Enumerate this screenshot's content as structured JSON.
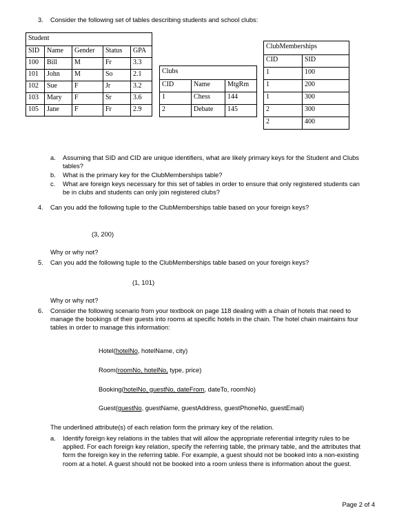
{
  "questions": {
    "q3": {
      "marker": "3.",
      "text": "Consider the following set of tables describing students and school clubs:"
    },
    "q3_subitems": [
      {
        "marker": "a.",
        "text": "Assuming that SID and CID are unique identifiers, what are likely primary keys for the Student and Clubs tables?"
      },
      {
        "marker": "b.",
        "text": "What is the primary key for the ClubMemberships table?"
      },
      {
        "marker": "c.",
        "text": "What are foreign keys necessary for this set of tables in order to ensure that only registered students can be in clubs and students can only join registered clubs?"
      }
    ],
    "q4": {
      "marker": "4.",
      "text": "Can you add the following tuple to the ClubMemberships table based on your foreign keys?",
      "tuple": "(3, 200)",
      "followup": "Why or why not?"
    },
    "q5": {
      "marker": "5.",
      "text": "Can you add the following tuple to the ClubMemberships table based on your foreign keys?",
      "tuple": "(1, 101)",
      "followup": "Why or why not?"
    },
    "q6": {
      "marker": "6.",
      "text": "Consider the following scenario from your textbook on page 118 dealing with a chain of hotels that need to manage the bookings of their guests into rooms at specific hotels in the chain. The hotel chain maintains four tables in order to manage this information:",
      "note": "The underlined attribute(s) of each relation form the primary key of the relation.",
      "subitems": [
        {
          "marker": "a.",
          "text": "Identify foreign key relations in the tables that will allow the appropriate referential integrity rules to be applied. For each foreign key relation, specify the referring table, the primary table, and the attributes that form the foreign key in the referring table. For example, a guest should not be booked into a non-existing room at a hotel. A guest should not be booked into a room unless there is information about the guest."
        }
      ]
    }
  },
  "schemas": [
    {
      "name": "Hotel",
      "open": "(",
      "key": "hotelNo",
      "rest": ", hotelName, city)"
    },
    {
      "name": "Room",
      "open": "(",
      "key": "roomNo, hotelNo,",
      "rest": " type, price)"
    },
    {
      "name": "Booking",
      "open": "(",
      "key": "hotelNo, guestNo, dateFrom",
      "rest": ", dateTo, roomNo)"
    },
    {
      "name": "Guest",
      "open": "(",
      "key": "guestNo",
      "rest": ", guestName, guestAddress, guestPhoneNo, guestEmail)"
    }
  ],
  "tables": {
    "student": {
      "title": "Student",
      "headers": [
        "SID",
        "Name",
        "Gender",
        "Status",
        "GPA"
      ],
      "rows": [
        [
          "100",
          "Bill",
          "M",
          "Fr",
          "3.3"
        ],
        [
          "101",
          "John",
          "M",
          "So",
          "2.1"
        ],
        [
          "102",
          "Sue",
          "F",
          "Jr",
          "3.2"
        ],
        [
          "103",
          "Mary",
          "F",
          "Sr",
          "3.6"
        ],
        [
          "105",
          "Jane",
          "F",
          "Fr",
          "2.9"
        ]
      ]
    },
    "clubs": {
      "title": "Clubs",
      "headers": [
        "CID",
        "Name",
        "MtgRm"
      ],
      "rows": [
        [
          "1",
          "Chess",
          "144"
        ],
        [
          "2",
          "Debate",
          "145"
        ]
      ]
    },
    "memberships": {
      "title": "ClubMemberships",
      "headers": [
        "CID",
        "SID"
      ],
      "rows": [
        [
          "1",
          "100"
        ],
        [
          "1",
          "200"
        ],
        [
          "1",
          "300"
        ],
        [
          "2",
          "300"
        ],
        [
          "2",
          "400"
        ]
      ]
    }
  },
  "footer": {
    "page_label": "Page 2 of 4"
  }
}
